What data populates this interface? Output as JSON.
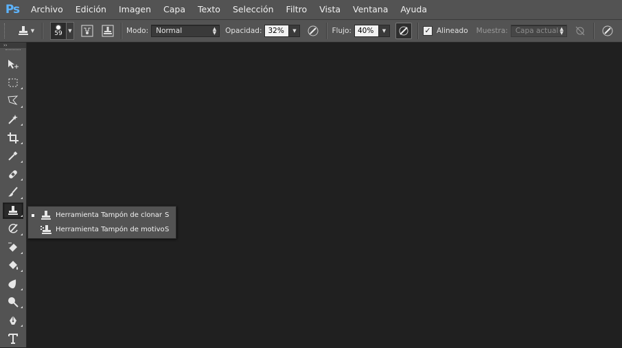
{
  "app": {
    "logo": "Ps"
  },
  "menu": [
    "Archivo",
    "Edición",
    "Imagen",
    "Capa",
    "Texto",
    "Selección",
    "Filtro",
    "Vista",
    "Ventana",
    "Ayuda"
  ],
  "options": {
    "brush_size": "59",
    "mode_label": "Modo:",
    "mode_value": "Normal",
    "opacity_label": "Opacidad:",
    "opacity_value": "32%",
    "flow_label": "Flujo:",
    "flow_value": "40%",
    "aligned_label": "Alineado",
    "aligned_checked": true,
    "sample_label": "Muestra:",
    "sample_value": "Capa actual"
  },
  "toolbox": {
    "collapse_glyph": "››",
    "tools": [
      {
        "name": "move-tool",
        "icon": "move-icon"
      },
      {
        "name": "marquee-tool",
        "icon": "rect-marquee-icon"
      },
      {
        "name": "lasso-tool",
        "icon": "polygonal-lasso-icon"
      },
      {
        "name": "magic-wand-tool",
        "icon": "magic-wand-icon"
      },
      {
        "name": "crop-tool",
        "icon": "crop-icon"
      },
      {
        "name": "eyedropper-tool",
        "icon": "eyedropper-icon"
      },
      {
        "name": "healing-brush-tool",
        "icon": "bandage-icon"
      },
      {
        "name": "brush-tool",
        "icon": "brush-icon"
      },
      {
        "name": "clone-stamp-tool",
        "icon": "stamp-icon",
        "active": true
      },
      {
        "name": "history-brush-tool",
        "icon": "history-brush-icon"
      },
      {
        "name": "eraser-tool",
        "icon": "eraser-icon"
      },
      {
        "name": "paint-bucket-tool",
        "icon": "paint-bucket-icon"
      },
      {
        "name": "blur-tool",
        "icon": "blur-icon"
      },
      {
        "name": "dodge-tool",
        "icon": "dodge-icon"
      },
      {
        "name": "pen-tool",
        "icon": "pen-icon"
      },
      {
        "name": "type-tool",
        "icon": "type-icon"
      }
    ]
  },
  "flyout": {
    "items": [
      {
        "label": "Herramienta Tampón de clonar",
        "shortcut": "S",
        "selected": true,
        "icon": "stamp-icon"
      },
      {
        "label": "Herramienta Tampón de motivo",
        "shortcut": "S",
        "selected": false,
        "icon": "pattern-stamp-icon"
      }
    ]
  },
  "colors": {
    "menu_bg": "#535353",
    "canvas_bg": "#202020",
    "logo": "#5db4ff"
  }
}
